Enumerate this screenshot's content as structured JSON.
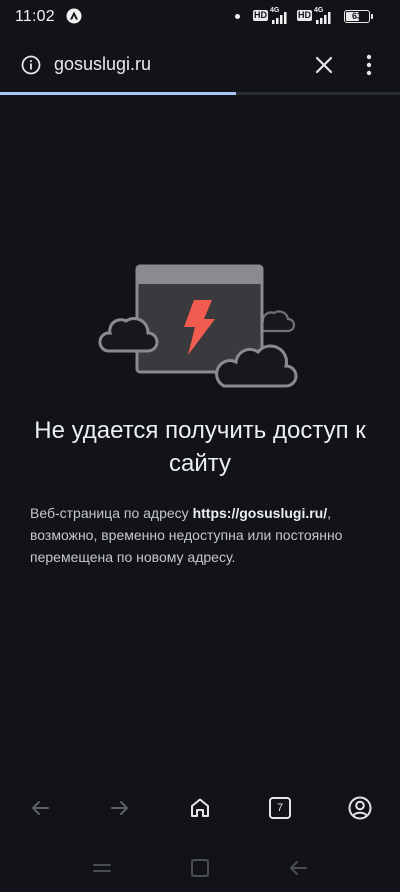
{
  "status_bar": {
    "time": "11:02",
    "network1": {
      "hd": "HD",
      "gen": "4G"
    },
    "network2": {
      "hd": "HD",
      "gen": "4G"
    },
    "battery": {
      "level": "63",
      "fraction": 0.63
    }
  },
  "url_bar": {
    "url": "gosuslugi.ru"
  },
  "page_load_progress": 0.59,
  "error_page": {
    "title": "Не удается получить доступ к сайту",
    "desc_prefix": "Веб-страница по адресу ",
    "desc_url": "https://gosuslugi.ru/",
    "desc_suffix": ", возможно, временно недоступна или постоянно перемещена по новому адресу."
  },
  "toolbar": {
    "tab_count": "7"
  },
  "colors": {
    "background": "#121318",
    "accent_progress": "#a9c7f7",
    "bolt": "#f25b4f"
  }
}
